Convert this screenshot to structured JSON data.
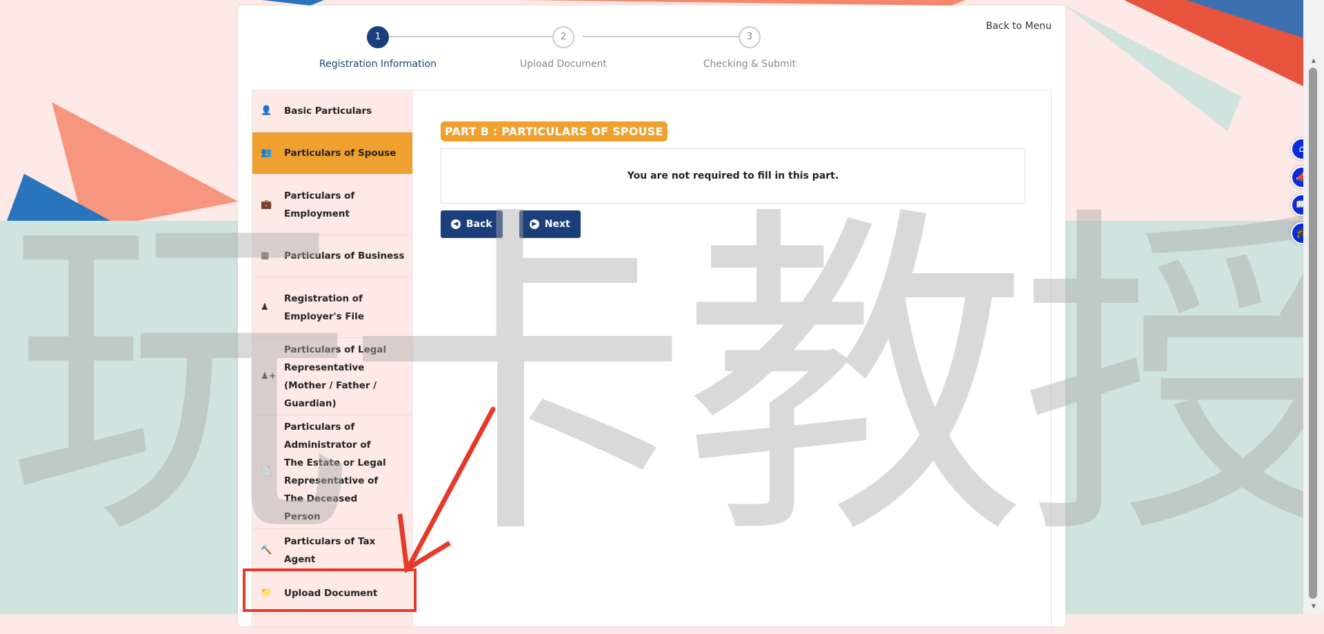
{
  "colors": {
    "accent": "#f0a02e",
    "primary": "#1b3f7a",
    "sidebar_bg": "#fde9e6",
    "annotation": "#e53a2a",
    "float_button": "#0a2bd8"
  },
  "header": {
    "back_to_menu": "Back to Menu"
  },
  "stepper": {
    "steps": [
      {
        "number": "1",
        "label": "Registration Information",
        "active": true
      },
      {
        "number": "2",
        "label": "Upload Document",
        "active": false
      },
      {
        "number": "3",
        "label": "Checking & Submit",
        "active": false
      }
    ]
  },
  "sidebar": {
    "items": [
      {
        "label": "Basic Particulars",
        "icon": "user-icon"
      },
      {
        "label": "Particulars of Spouse",
        "icon": "users-icon",
        "active": true
      },
      {
        "label": "Particulars of Employment",
        "icon": "briefcase-icon"
      },
      {
        "label": "Particulars of Business",
        "icon": "building-icon"
      },
      {
        "label": "Registration of Employer's File",
        "icon": "user-tie-icon"
      },
      {
        "label": "Particulars of Legal Representative (Mother / Father / Guardian)",
        "icon": "user-plus-icon"
      },
      {
        "label": "Particulars of Administrator of The Estate or Legal Representative of The Deceased Person",
        "icon": "file-icon"
      },
      {
        "label": "Particulars of Tax Agent",
        "icon": "gavel-icon"
      },
      {
        "label": "Upload Document",
        "icon": "folder-icon"
      }
    ]
  },
  "main": {
    "part_title": "PART B : PARTICULARS OF SPOUSE",
    "notice": "You are not required to fill in this part.",
    "back_label": "Back",
    "next_label": "Next"
  },
  "watermark": "玩卡教授",
  "float_buttons": [
    "home-icon",
    "megaphone-icon",
    "book-icon",
    "graduation-cap-icon"
  ]
}
